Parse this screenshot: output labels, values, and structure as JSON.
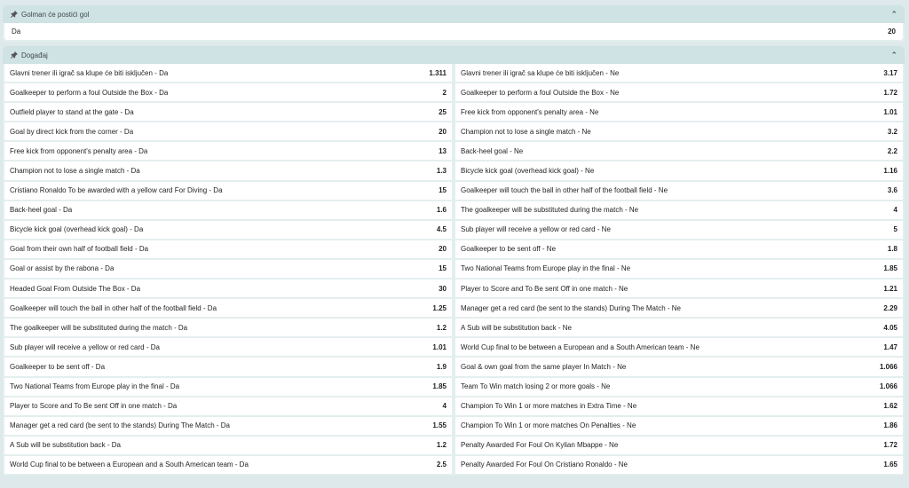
{
  "goalkeeper_section": {
    "title": "Golman će postići gol",
    "row": {
      "label": "Da",
      "odd": "20"
    }
  },
  "event_section": {
    "title": "Događaj",
    "left": [
      {
        "label": "Glavni trener ili igrač sa klupe će biti isključen - Da",
        "odd": "1.311"
      },
      {
        "label": "Goalkeeper to perform a foul Outside the Box - Da",
        "odd": "2"
      },
      {
        "label": "Outfield player to stand at the gate - Da",
        "odd": "25"
      },
      {
        "label": "Goal by direct kick from the corner - Da",
        "odd": "20"
      },
      {
        "label": "Free kick from opponent's penalty area - Da",
        "odd": "13"
      },
      {
        "label": "Champion not to lose a single match - Da",
        "odd": "1.3"
      },
      {
        "label": "Cristiano Ronaldo To be awarded with a yellow card For Diving - Da",
        "odd": "15"
      },
      {
        "label": "Back-heel goal - Da",
        "odd": "1.6"
      },
      {
        "label": "Bicycle kick goal (overhead kick goal) - Da",
        "odd": "4.5"
      },
      {
        "label": "Goal from their own half of football field - Da",
        "odd": "20"
      },
      {
        "label": "Goal or assist by the rabona - Da",
        "odd": "15"
      },
      {
        "label": "Headed Goal From Outside The Box - Da",
        "odd": "30"
      },
      {
        "label": "Goalkeeper will touch the ball in other half of the football field - Da",
        "odd": "1.25"
      },
      {
        "label": "The goalkeeper will be substituted during the match - Da",
        "odd": "1.2"
      },
      {
        "label": "Sub player will receive a yellow or red card - Da",
        "odd": "1.01"
      },
      {
        "label": "Goalkeeper to be sent off - Da",
        "odd": "1.9"
      },
      {
        "label": "Two National Teams from Europe play in the final - Da",
        "odd": "1.85"
      },
      {
        "label": "Player to Score and To Be sent Off in one match - Da",
        "odd": "4"
      },
      {
        "label": "Manager get a red card (be sent to the stands) During The Match - Da",
        "odd": "1.55"
      },
      {
        "label": "A Sub will be substitution back - Da",
        "odd": "1.2"
      },
      {
        "label": "World Cup final to be between a European and a South American team - Da",
        "odd": "2.5"
      }
    ],
    "right": [
      {
        "label": "Glavni trener ili igrač sa klupe će biti isključen - Ne",
        "odd": "3.17"
      },
      {
        "label": "Goalkeeper to perform a foul Outside the Box - Ne",
        "odd": "1.72"
      },
      {
        "label": "Free kick from opponent's penalty area - Ne",
        "odd": "1.01"
      },
      {
        "label": "Champion not to lose a single match - Ne",
        "odd": "3.2"
      },
      {
        "label": "Back-heel goal - Ne",
        "odd": "2.2"
      },
      {
        "label": "Bicycle kick goal (overhead kick goal) - Ne",
        "odd": "1.16"
      },
      {
        "label": "Goalkeeper will touch the ball in other half of the football field - Ne",
        "odd": "3.6"
      },
      {
        "label": "The goalkeeper will be substituted during the match - Ne",
        "odd": "4"
      },
      {
        "label": "Sub player will receive a yellow or red card - Ne",
        "odd": "5"
      },
      {
        "label": "Goalkeeper to be sent off - Ne",
        "odd": "1.8"
      },
      {
        "label": "Two National Teams from Europe play in the final - Ne",
        "odd": "1.85"
      },
      {
        "label": "Player to Score and To Be sent Off in one match - Ne",
        "odd": "1.21"
      },
      {
        "label": "Manager get a red card (be sent to the stands) During The Match - Ne",
        "odd": "2.29"
      },
      {
        "label": "A Sub will be substitution back - Ne",
        "odd": "4.05"
      },
      {
        "label": "World Cup final to be between a European and a South American team - Ne",
        "odd": "1.47"
      },
      {
        "label": "Goal & own goal from the same player In Match - Ne",
        "odd": "1.066"
      },
      {
        "label": "Team To Win match losing 2 or more goals - Ne",
        "odd": "1.066"
      },
      {
        "label": "Champion To Win 1 or more matches in Extra Time - Ne",
        "odd": "1.62"
      },
      {
        "label": "Champion To Win 1 or more matches On Penalties - Ne",
        "odd": "1.86"
      },
      {
        "label": "Penalty Awarded For Foul On Kylian Mbappe - Ne",
        "odd": "1.72"
      },
      {
        "label": "Penalty Awarded For Foul On Cristiano Ronaldo - Ne",
        "odd": "1.65"
      }
    ]
  }
}
